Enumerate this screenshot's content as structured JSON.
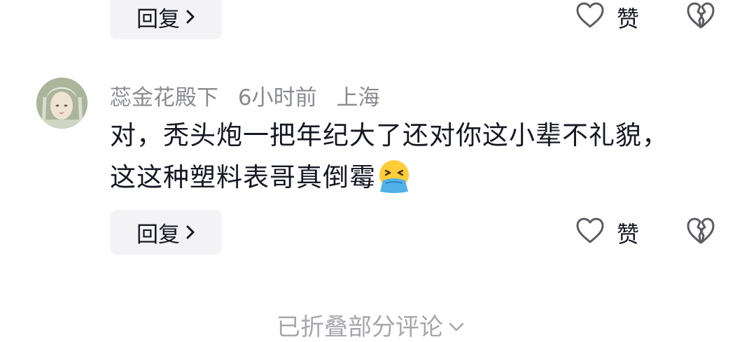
{
  "top_actions": {
    "reply_label": "回复",
    "like_label": "赞",
    "icons": {
      "like": "heart-outline-icon",
      "dislike": "broken-heart-icon",
      "reply_more": "chevron-right-icon"
    }
  },
  "comment": {
    "username": "蕊金花殿下",
    "time": "6小时前",
    "location": "上海",
    "text": "对，秃头炮一把年纪大了还对你这小辈不礼貌，这这种塑料表哥真倒霉",
    "emoji": "vomit-face-emoji",
    "reply_label": "回复",
    "like_label": "赞"
  },
  "footer": {
    "collapsed_label": "已折叠部分评论",
    "icon": "chevron-down-icon"
  },
  "colors": {
    "text_primary": "#161823",
    "text_secondary": "#8a8b91",
    "button_bg": "#f3f3f5",
    "icon_stroke": "#5b5c63"
  }
}
